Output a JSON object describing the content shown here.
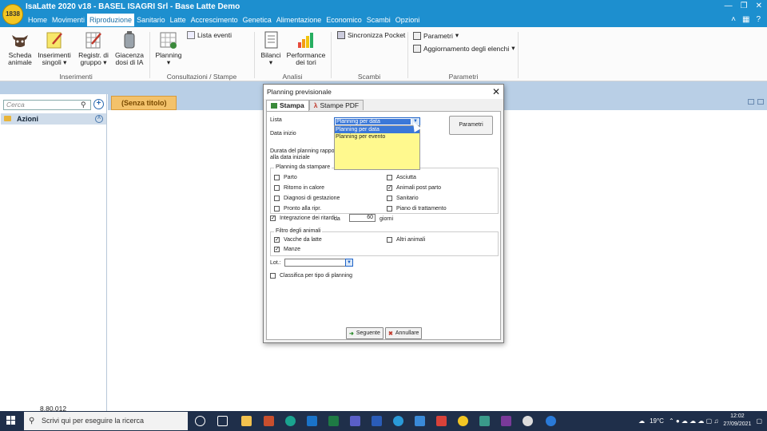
{
  "app": {
    "logo_text": "1838",
    "title": "IsaLatte 2020 v18 - BASEL ISAGRI Srl - Base Latte Demo"
  },
  "menu": [
    "Home",
    "Movimenti",
    "Riproduzione",
    "Sanitario",
    "Latte",
    "Accrescimento",
    "Genetica",
    "Alimentazione",
    "Economico",
    "Scambi",
    "Opzioni"
  ],
  "ribbon": {
    "scheda": "Scheda animale",
    "inserimenti": "Inserimenti singoli",
    "registr": "Registr. di gruppo",
    "giacenza": "Giacenza dosi di IA",
    "planning": "Planning",
    "lista_eventi": "Lista eventi",
    "bilanci": "Bilanci",
    "performance": "Performance dei tori",
    "sincronizza": "Sincronizza Pocket",
    "parametri": "Parametri",
    "aggiornamento": "Aggiornamento degli elenchi",
    "groups": {
      "inserimenti": "Inserimenti",
      "consultazioni": "Consultazioni / Stampe",
      "analisi": "Analisi",
      "scambi": "Scambi",
      "parametri": "Parametri"
    }
  },
  "left": {
    "search_placeholder": "Cerca",
    "azioni": "Azioni",
    "version": "8.80.012"
  },
  "doctab": "(Senza titolo)",
  "dialog": {
    "title": "Planning previsionale",
    "tab_stampa": "Stampa",
    "tab_pdf": "Stampe PDF",
    "lista_label": "Lista",
    "combo_value": "Planning per data",
    "options": [
      "Planning per data",
      "Planning per evento"
    ],
    "data_inizio": "Data inizio",
    "parametri_btn": "Parametri",
    "durata": "Durata del planning rapport",
    "durata2": "alla data iniziale",
    "planning_legend": "Planning da stampare",
    "left_checks": [
      {
        "label": "Parto",
        "checked": false
      },
      {
        "label": "Ritorno in calore",
        "checked": false
      },
      {
        "label": "Diagnosi di gestazione",
        "checked": false
      },
      {
        "label": "Pronto alla ripr.",
        "checked": false
      }
    ],
    "right_checks": [
      {
        "label": "Asciutta",
        "checked": false
      },
      {
        "label": "Animali post parto",
        "checked": true
      },
      {
        "label": "Sanitario",
        "checked": false
      },
      {
        "label": "Piano di trattamento",
        "checked": false
      }
    ],
    "integrazione": "Integrazione dei ritardi",
    "da": "da",
    "giorni_value": "60",
    "giorni": "giorni",
    "filtro_legend": "Filtro degli animali",
    "vacche": "Vacche da latte",
    "manze": "Manze",
    "altri": "Altri animali",
    "lot": "Lot.:",
    "classifica": "Classifica per tipo di planning",
    "seguente": "Seguente",
    "annullare": "Annullare"
  },
  "taskbar": {
    "search": "Scrivi qui per eseguire la ricerca",
    "temp": "19°C",
    "time": "12:02",
    "date": "27/09/2021"
  }
}
